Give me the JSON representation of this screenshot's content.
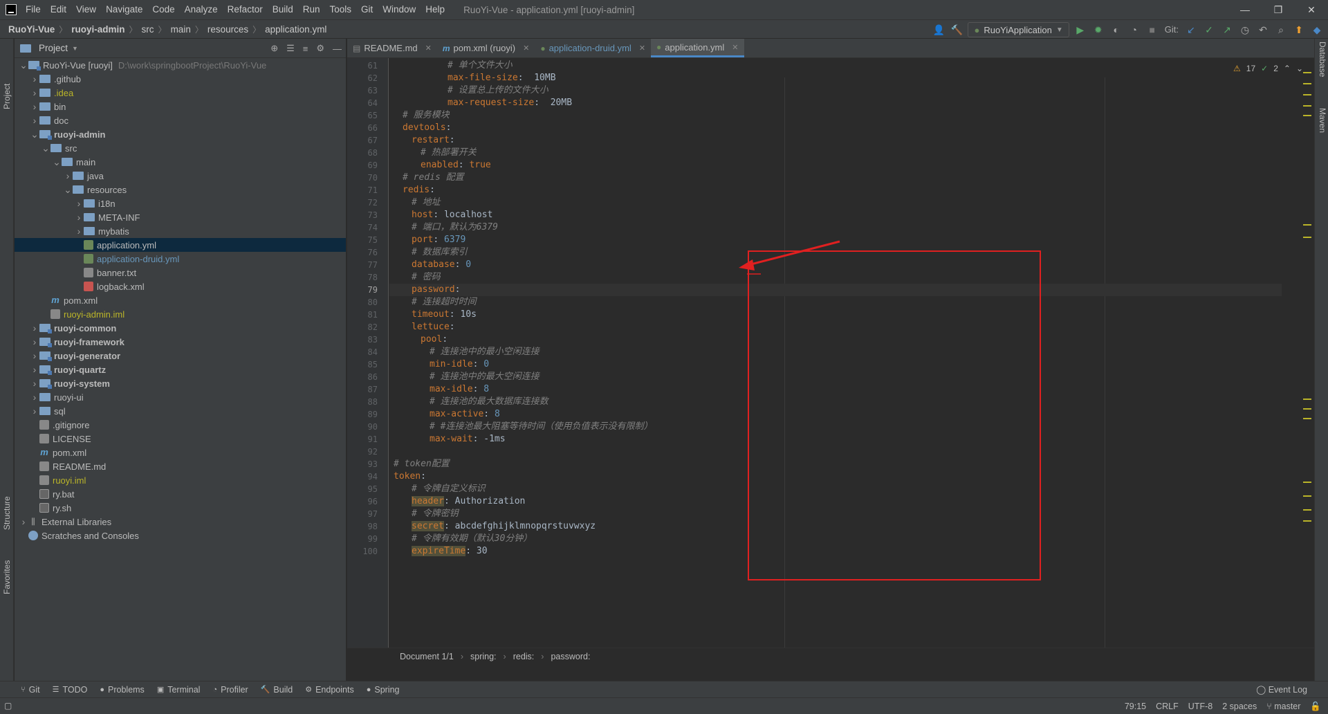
{
  "app": {
    "title": "RuoYi-Vue - application.yml [ruoyi-admin]"
  },
  "menu": [
    "File",
    "Edit",
    "View",
    "Navigate",
    "Code",
    "Analyze",
    "Refactor",
    "Build",
    "Run",
    "Tools",
    "Git",
    "Window",
    "Help"
  ],
  "window_controls": [
    "—",
    "❐",
    "✕"
  ],
  "breadcrumb": [
    "RuoYi-Vue",
    "ruoyi-admin",
    "src",
    "main",
    "resources",
    "application.yml"
  ],
  "run_config": "RuoYiApplication",
  "git_label": "Git:",
  "project_panel": {
    "title": "Project"
  },
  "side_tabs": {
    "left_top": "Project",
    "left_structure": "Structure",
    "left_favorites": "Favorites",
    "right_database": "Database",
    "right_maven": "Maven"
  },
  "tree": [
    {
      "label": "RuoYi-Vue [ruoyi]",
      "path": "D:\\work\\springbootProject\\RuoYi-Vue",
      "depth": 0,
      "arrow": "v",
      "icon": "folder-mod",
      "style": "normal"
    },
    {
      "label": ".github",
      "depth": 1,
      "arrow": ">",
      "icon": "folder",
      "style": "normal"
    },
    {
      "label": ".idea",
      "depth": 1,
      "arrow": ">",
      "icon": "folder",
      "style": "yellow"
    },
    {
      "label": "bin",
      "depth": 1,
      "arrow": ">",
      "icon": "folder",
      "style": "normal"
    },
    {
      "label": "doc",
      "depth": 1,
      "arrow": ">",
      "icon": "folder",
      "style": "normal"
    },
    {
      "label": "ruoyi-admin",
      "depth": 1,
      "arrow": "v",
      "icon": "folder-mod",
      "style": "bold"
    },
    {
      "label": "src",
      "depth": 2,
      "arrow": "v",
      "icon": "folder",
      "style": "normal"
    },
    {
      "label": "main",
      "depth": 3,
      "arrow": "v",
      "icon": "folder",
      "style": "normal"
    },
    {
      "label": "java",
      "depth": 4,
      "arrow": ">",
      "icon": "folder",
      "style": "normal"
    },
    {
      "label": "resources",
      "depth": 4,
      "arrow": "v",
      "icon": "folder",
      "style": "normal"
    },
    {
      "label": "i18n",
      "depth": 5,
      "arrow": ">",
      "icon": "folder",
      "style": "normal"
    },
    {
      "label": "META-INF",
      "depth": 5,
      "arrow": ">",
      "icon": "folder",
      "style": "normal"
    },
    {
      "label": "mybatis",
      "depth": 5,
      "arrow": ">",
      "icon": "folder",
      "style": "normal"
    },
    {
      "label": "application.yml",
      "depth": 5,
      "arrow": "",
      "icon": "yml",
      "style": "normal",
      "selected": true
    },
    {
      "label": "application-druid.yml",
      "depth": 5,
      "arrow": "",
      "icon": "yml",
      "style": "blue"
    },
    {
      "label": "banner.txt",
      "depth": 5,
      "arrow": "",
      "icon": "txt",
      "style": "normal"
    },
    {
      "label": "logback.xml",
      "depth": 5,
      "arrow": "",
      "icon": "xml",
      "style": "normal"
    },
    {
      "label": "pom.xml",
      "depth": 2,
      "arrow": "",
      "icon": "m",
      "style": "normal"
    },
    {
      "label": "ruoyi-admin.iml",
      "depth": 2,
      "arrow": "",
      "icon": "iml",
      "style": "yellow"
    },
    {
      "label": "ruoyi-common",
      "depth": 1,
      "arrow": ">",
      "icon": "folder-mod",
      "style": "bold"
    },
    {
      "label": "ruoyi-framework",
      "depth": 1,
      "arrow": ">",
      "icon": "folder-mod",
      "style": "bold"
    },
    {
      "label": "ruoyi-generator",
      "depth": 1,
      "arrow": ">",
      "icon": "folder-mod",
      "style": "bold"
    },
    {
      "label": "ruoyi-quartz",
      "depth": 1,
      "arrow": ">",
      "icon": "folder-mod",
      "style": "bold"
    },
    {
      "label": "ruoyi-system",
      "depth": 1,
      "arrow": ">",
      "icon": "folder-mod",
      "style": "bold"
    },
    {
      "label": "ruoyi-ui",
      "depth": 1,
      "arrow": ">",
      "icon": "folder",
      "style": "normal"
    },
    {
      "label": "sql",
      "depth": 1,
      "arrow": ">",
      "icon": "folder",
      "style": "normal"
    },
    {
      "label": ".gitignore",
      "depth": 1,
      "arrow": "",
      "icon": "txt",
      "style": "normal"
    },
    {
      "label": "LICENSE",
      "depth": 1,
      "arrow": "",
      "icon": "txt",
      "style": "normal"
    },
    {
      "label": "pom.xml",
      "depth": 1,
      "arrow": "",
      "icon": "m",
      "style": "normal"
    },
    {
      "label": "README.md",
      "depth": 1,
      "arrow": "",
      "icon": "txt",
      "style": "normal"
    },
    {
      "label": "ruoyi.iml",
      "depth": 1,
      "arrow": "",
      "icon": "iml",
      "style": "yellow"
    },
    {
      "label": "ry.bat",
      "depth": 1,
      "arrow": "",
      "icon": "bat",
      "style": "normal"
    },
    {
      "label": "ry.sh",
      "depth": 1,
      "arrow": "",
      "icon": "bat",
      "style": "normal"
    },
    {
      "label": "External Libraries",
      "depth": 0,
      "arrow": ">",
      "icon": "lib",
      "style": "normal"
    },
    {
      "label": "Scratches and Consoles",
      "depth": 0,
      "arrow": "",
      "icon": "scratch",
      "style": "normal"
    }
  ],
  "editor_tabs": [
    {
      "label": "README.md",
      "icon": "md",
      "active": false,
      "style": "normal"
    },
    {
      "label": "pom.xml (ruoyi)",
      "icon": "m",
      "active": false,
      "style": "normal"
    },
    {
      "label": "application-druid.yml",
      "icon": "yml",
      "active": false,
      "style": "blue"
    },
    {
      "label": "application.yml",
      "icon": "yml",
      "active": true,
      "style": "normal"
    }
  ],
  "inspections": {
    "warnings": "17",
    "weak": "2"
  },
  "current_line": 79,
  "code_lines": [
    {
      "n": 61,
      "i": 6,
      "t": [
        [
          "cm",
          "# 单个文件大小"
        ]
      ]
    },
    {
      "n": 62,
      "i": 6,
      "t": [
        [
          "k",
          "max-file-size"
        ],
        [
          "v",
          ":  10MB"
        ]
      ]
    },
    {
      "n": 63,
      "i": 6,
      "t": [
        [
          "cm",
          "# 设置总上传的文件大小"
        ]
      ]
    },
    {
      "n": 64,
      "i": 6,
      "t": [
        [
          "k",
          "max-request-size"
        ],
        [
          "v",
          ":  20MB"
        ]
      ]
    },
    {
      "n": 65,
      "i": 1,
      "t": [
        [
          "cm",
          "# 服务模块"
        ]
      ]
    },
    {
      "n": 66,
      "i": 1,
      "t": [
        [
          "k",
          "devtools"
        ],
        [
          "v",
          ":"
        ]
      ]
    },
    {
      "n": 67,
      "i": 2,
      "t": [
        [
          "k",
          "restart"
        ],
        [
          "v",
          ":"
        ]
      ]
    },
    {
      "n": 68,
      "i": 3,
      "t": [
        [
          "cm",
          "# 热部署开关"
        ]
      ]
    },
    {
      "n": 69,
      "i": 3,
      "t": [
        [
          "k",
          "enabled"
        ],
        [
          "v",
          ": "
        ],
        [
          "k",
          "true"
        ]
      ]
    },
    {
      "n": 70,
      "i": 1,
      "t": [
        [
          "cm",
          "# redis 配置"
        ]
      ]
    },
    {
      "n": 71,
      "i": 1,
      "t": [
        [
          "k",
          "redis"
        ],
        [
          "v",
          ":"
        ]
      ]
    },
    {
      "n": 72,
      "i": 2,
      "t": [
        [
          "cm",
          "# 地址"
        ]
      ]
    },
    {
      "n": 73,
      "i": 2,
      "t": [
        [
          "k",
          "host"
        ],
        [
          "v",
          ": localhost"
        ]
      ]
    },
    {
      "n": 74,
      "i": 2,
      "t": [
        [
          "cm",
          "# 端口，默认为6379"
        ]
      ]
    },
    {
      "n": 75,
      "i": 2,
      "t": [
        [
          "k",
          "port"
        ],
        [
          "v",
          ": "
        ],
        [
          "n",
          "6379"
        ]
      ]
    },
    {
      "n": 76,
      "i": 2,
      "t": [
        [
          "cm",
          "# 数据库索引"
        ]
      ]
    },
    {
      "n": 77,
      "i": 2,
      "t": [
        [
          "k",
          "database"
        ],
        [
          "v",
          ": "
        ],
        [
          "n",
          "0"
        ]
      ]
    },
    {
      "n": 78,
      "i": 2,
      "t": [
        [
          "cm",
          "# 密码"
        ]
      ]
    },
    {
      "n": 79,
      "i": 2,
      "t": [
        [
          "k",
          "password"
        ],
        [
          "v",
          ":"
        ]
      ]
    },
    {
      "n": 80,
      "i": 2,
      "t": [
        [
          "cm",
          "# 连接超时时间"
        ]
      ]
    },
    {
      "n": 81,
      "i": 2,
      "t": [
        [
          "k",
          "timeout"
        ],
        [
          "v",
          ": 10s"
        ]
      ]
    },
    {
      "n": 82,
      "i": 2,
      "t": [
        [
          "k",
          "lettuce"
        ],
        [
          "v",
          ":"
        ]
      ]
    },
    {
      "n": 83,
      "i": 3,
      "t": [
        [
          "k",
          "pool"
        ],
        [
          "v",
          ":"
        ]
      ]
    },
    {
      "n": 84,
      "i": 4,
      "t": [
        [
          "cm",
          "# 连接池中的最小空闲连接"
        ]
      ]
    },
    {
      "n": 85,
      "i": 4,
      "t": [
        [
          "k",
          "min-idle"
        ],
        [
          "v",
          ": "
        ],
        [
          "n",
          "0"
        ]
      ]
    },
    {
      "n": 86,
      "i": 4,
      "t": [
        [
          "cm",
          "# 连接池中的最大空闲连接"
        ]
      ]
    },
    {
      "n": 87,
      "i": 4,
      "t": [
        [
          "k",
          "max-idle"
        ],
        [
          "v",
          ": "
        ],
        [
          "n",
          "8"
        ]
      ]
    },
    {
      "n": 88,
      "i": 4,
      "t": [
        [
          "cm",
          "# 连接池的最大数据库连接数"
        ]
      ]
    },
    {
      "n": 89,
      "i": 4,
      "t": [
        [
          "k",
          "max-active"
        ],
        [
          "v",
          ": "
        ],
        [
          "n",
          "8"
        ]
      ]
    },
    {
      "n": 90,
      "i": 4,
      "t": [
        [
          "cm",
          "# #连接池最大阻塞等待时间（使用负值表示没有限制）"
        ]
      ]
    },
    {
      "n": 91,
      "i": 4,
      "t": [
        [
          "k",
          "max-wait"
        ],
        [
          "v",
          ": -1ms"
        ]
      ]
    },
    {
      "n": 92,
      "i": 0,
      "t": []
    },
    {
      "n": 93,
      "i": 0,
      "t": [
        [
          "cm",
          "# token配置"
        ]
      ]
    },
    {
      "n": 94,
      "i": 0,
      "t": [
        [
          "k",
          "token"
        ],
        [
          "v",
          ":"
        ]
      ]
    },
    {
      "n": 95,
      "i": 2,
      "t": [
        [
          "cm",
          "# 令牌自定义标识"
        ]
      ]
    },
    {
      "n": 96,
      "i": 2,
      "t": [
        [
          "kh",
          "header"
        ],
        [
          "v",
          ": Authorization"
        ]
      ]
    },
    {
      "n": 97,
      "i": 2,
      "t": [
        [
          "cm",
          "# 令牌密钥"
        ]
      ]
    },
    {
      "n": 98,
      "i": 2,
      "t": [
        [
          "kh",
          "secret"
        ],
        [
          "v",
          ": abcdefghijklmnopqrstuvwxyz"
        ]
      ]
    },
    {
      "n": 99,
      "i": 2,
      "t": [
        [
          "cm",
          "# 令牌有效期（默认30分钟）"
        ]
      ]
    },
    {
      "n": 100,
      "i": 2,
      "t": [
        [
          "kh",
          "expireTime"
        ],
        [
          "v",
          ": 30"
        ]
      ]
    }
  ],
  "editor_breadcrumb": [
    "Document 1/1",
    "spring:",
    "redis:",
    "password:"
  ],
  "bottom_tools": [
    "Git",
    "TODO",
    "Problems",
    "Terminal",
    "Profiler",
    "Build",
    "Endpoints",
    "Spring"
  ],
  "event_log": "Event Log",
  "status": {
    "position": "79:15",
    "line_sep": "CRLF",
    "encoding": "UTF-8",
    "indent": "2 spaces",
    "branch": "master"
  },
  "colors": {
    "annotation_red": "#e02020",
    "accent": "#4a88c7",
    "keyword": "#cc7832",
    "comment": "#808080",
    "number": "#6897bb"
  }
}
